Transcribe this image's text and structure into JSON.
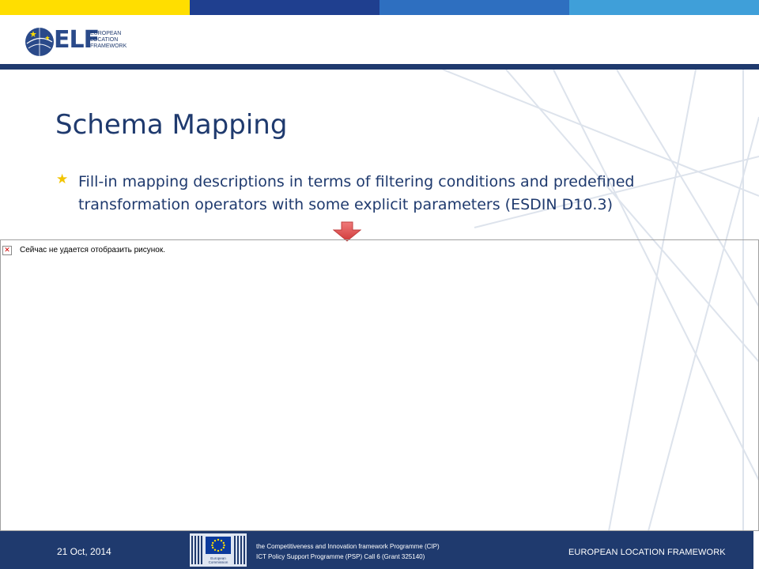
{
  "colors": {
    "topbar": [
      "#ffde00",
      "#1f3f8f",
      "#2e6fc0",
      "#3f9fd9"
    ],
    "navy": "#1f3a6e",
    "star": "#f2c400",
    "arrow": "#e05050"
  },
  "logo": {
    "text": "ELF",
    "subtitle_lines": [
      "EUROPEAN",
      "LOCATION",
      "FRAMEWORK"
    ],
    "icon": "globe-stars-icon"
  },
  "slide": {
    "title": "Schema Mapping",
    "bullet_icon": "star-icon",
    "bullet_text": "Fill-in mapping descriptions in terms of filtering conditions and predefined transformation operators with some explicit parameters (ESDIN D10.3)",
    "arrow_icon": "down-arrow-icon"
  },
  "broken_image": {
    "icon": "broken-image-icon",
    "message": "Сейчас не удается отобразить рисунок."
  },
  "footer": {
    "date": "21 Oct, 2014",
    "ec_logo_label_lines": [
      "European",
      "Commission"
    ],
    "programme_line1": "the Competitiveness and Innovation framework Programme (CIP)",
    "programme_line2": "ICT Policy Support Programme (PSP) Call 6 (Grant 325140)",
    "framework": "EUROPEAN LOCATION FRAMEWORK"
  }
}
